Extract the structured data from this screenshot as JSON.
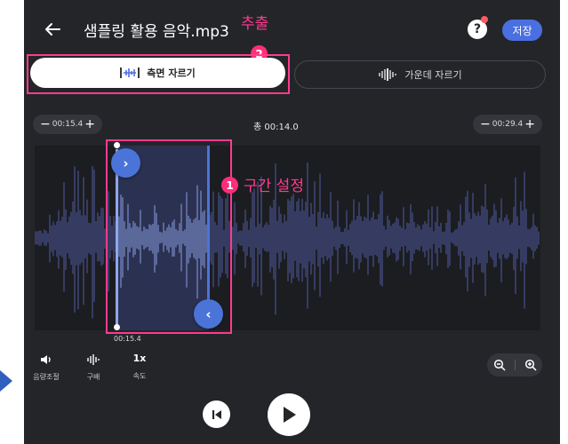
{
  "header": {
    "title": "샘플링 활용 음악.mp3",
    "help_label": "?",
    "save_label": "저장"
  },
  "annotations": {
    "extract_label": "추출",
    "tab_badge": "2",
    "range_badge": "1",
    "range_label": "구간 설정"
  },
  "tabs": [
    {
      "label": "측면 자르기",
      "active": true
    },
    {
      "label": "가운데 자르기",
      "active": false
    }
  ],
  "time": {
    "start": "00:15.4",
    "end": "00:29.4",
    "total": "총 00:14.0",
    "marker": "00:15.4",
    "minus": "−",
    "plus": "+"
  },
  "controls": {
    "volume_label": "음량조절",
    "tempo_label": "구배",
    "speed_value": "1x",
    "speed_label": "속도"
  },
  "icons": [
    "back-arrow-icon",
    "help-icon",
    "side-cut-icon",
    "middle-cut-icon",
    "volume-icon",
    "tempo-icon",
    "zoom-out-icon",
    "zoom-in-icon",
    "skip-start-icon",
    "play-icon",
    "chevron-right-icon",
    "chevron-left-icon"
  ],
  "colors": {
    "background": "#242529",
    "accent": "#4a6fe0",
    "waveform": "#5b66b8",
    "waveform_selected": "#8fa6ee",
    "annotation": "#ff3b8d"
  }
}
